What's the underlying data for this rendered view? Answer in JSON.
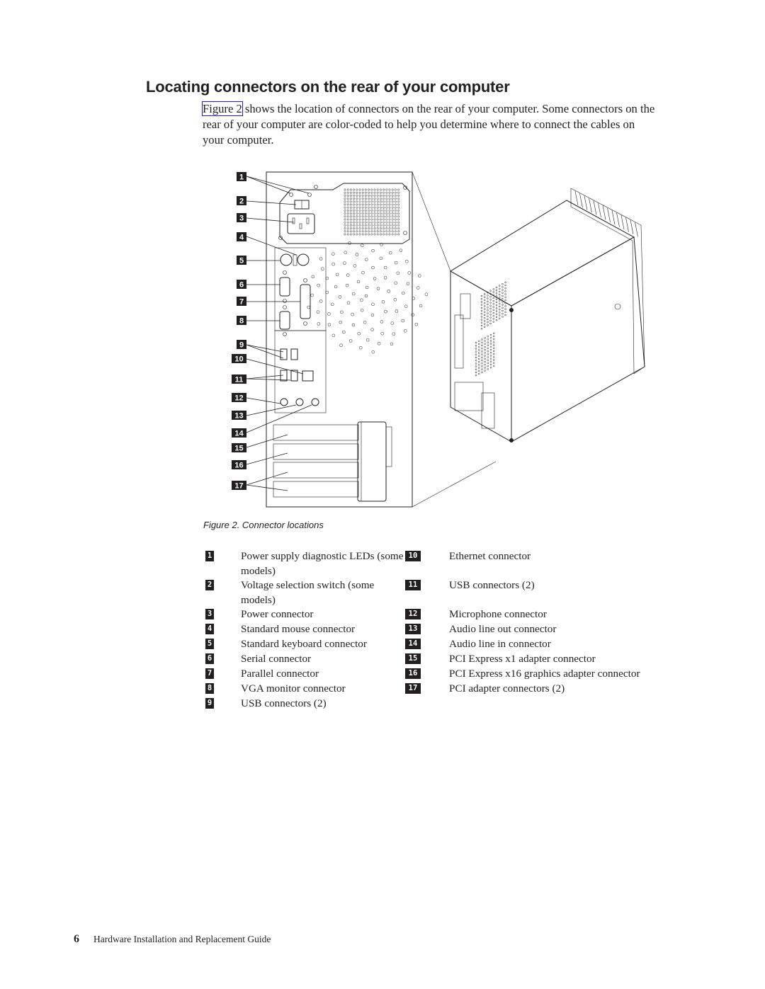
{
  "page": {
    "heading": "Locating connectors on the rear of your computer",
    "intro": {
      "link_text": "Figure 2",
      "text": " shows the location of connectors on the rear of your computer. Some connectors on the rear of your computer are color-coded to help you determine where to connect the cables on your computer."
    },
    "figure": {
      "caption": "Figure 2. Connector locations",
      "callouts": [
        "1",
        "2",
        "3",
        "4",
        "5",
        "6",
        "7",
        "8",
        "9",
        "10",
        "11",
        "12",
        "13",
        "14",
        "15",
        "16",
        "17"
      ]
    },
    "legend": {
      "left": [
        {
          "num": "1",
          "label": "Power supply diagnostic LEDs (some models)"
        },
        {
          "num": "2",
          "label": "Voltage selection switch (some models)"
        },
        {
          "num": "3",
          "label": "Power connector"
        },
        {
          "num": "4",
          "label": "Standard mouse connector"
        },
        {
          "num": "5",
          "label": "Standard keyboard connector"
        },
        {
          "num": "6",
          "label": "Serial connector"
        },
        {
          "num": "7",
          "label": "Parallel connector"
        },
        {
          "num": "8",
          "label": "VGA monitor connector"
        },
        {
          "num": "9",
          "label": "USB connectors (2)"
        }
      ],
      "right": [
        {
          "num": "10",
          "label": "Ethernet connector"
        },
        {
          "num": "11",
          "label": "USB connectors (2)"
        },
        {
          "num": "12",
          "label": "Microphone connector"
        },
        {
          "num": "13",
          "label": "Audio line out connector"
        },
        {
          "num": "14",
          "label": "Audio line in connector"
        },
        {
          "num": "15",
          "label": "PCI Express x1 adapter connector"
        },
        {
          "num": "16",
          "label": "PCI Express x16 graphics adapter connector"
        },
        {
          "num": "17",
          "label": "PCI adapter connectors (2)"
        }
      ]
    },
    "footer": {
      "page_number": "6",
      "title": "Hardware Installation and Replacement Guide"
    }
  }
}
